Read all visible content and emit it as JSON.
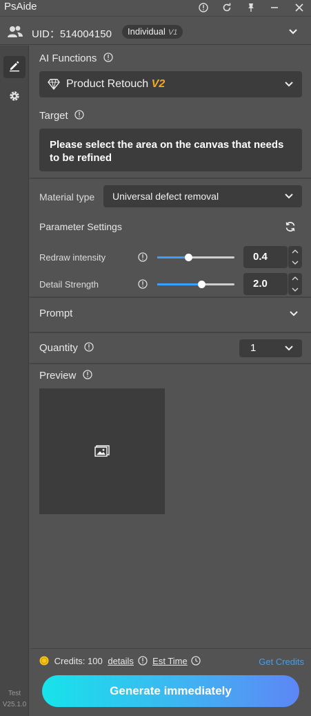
{
  "app": {
    "title": "PsAide"
  },
  "user": {
    "uid": "UID：514004150",
    "badge": "Individual",
    "badge_suffix": "V1"
  },
  "sidebar": {
    "version_line1": "Test",
    "version_line2": "V25.1.0"
  },
  "ai_functions": {
    "label": "AI Functions",
    "selected": "Product Retouch",
    "selected_tag": "V2"
  },
  "target": {
    "label": "Target",
    "message": "Please select the area on the canvas that needs to be refined"
  },
  "material": {
    "label": "Material type",
    "selected": "Universal defect removal"
  },
  "parameters": {
    "label": "Parameter Settings",
    "redraw": {
      "label": "Redraw intensity",
      "value": "0.4",
      "fraction": 0.4
    },
    "detail": {
      "label": "Detail Strength",
      "value": "2.0",
      "fraction": 0.57
    }
  },
  "prompt": {
    "label": "Prompt"
  },
  "quantity": {
    "label": "Quantity",
    "value": "1"
  },
  "preview": {
    "label": "Preview"
  },
  "footer": {
    "credits_label": "Credits: 100",
    "details_link": "details",
    "est_time_link": "Est Time",
    "get_credits": "Get Credits",
    "generate_button": "Generate immediately"
  },
  "colors": {
    "accent": "#3aa0ff",
    "tag": "#f5a623",
    "coin": "#f5c518"
  }
}
